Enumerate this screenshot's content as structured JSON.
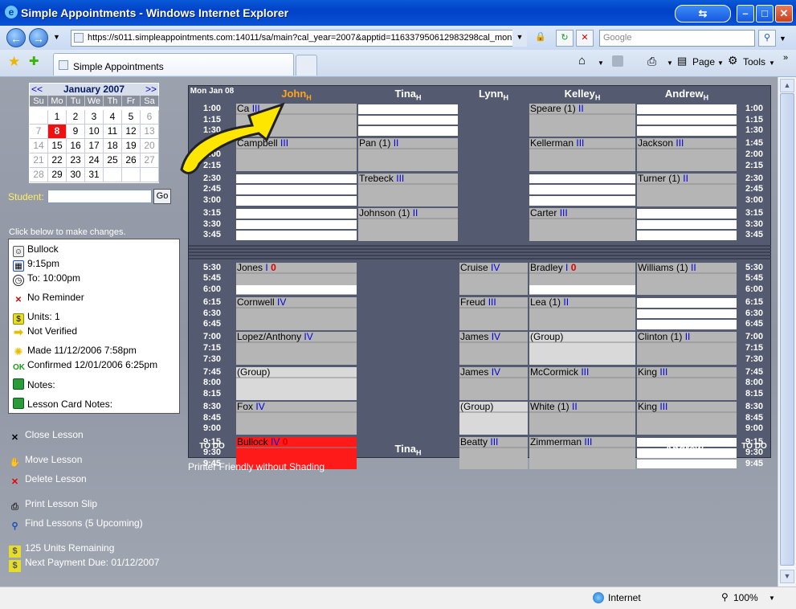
{
  "window": {
    "title": "Simple Appointments - Windows Internet Explorer"
  },
  "browser": {
    "url": "https://s011.simpleappointments.com:14011/sa/main?cal_year=2007&apptid=116337950612983298cal_mon",
    "search_placeholder": "Google",
    "tab_title": "Simple Appointments",
    "page_label": "Page",
    "tools_label": "Tools"
  },
  "status": {
    "zone": "Internet",
    "zoom": "100%"
  },
  "calendar": {
    "prev": "<<",
    "next": ">>",
    "month": "January 2007",
    "day_headers": [
      "Su",
      "Mo",
      "Tu",
      "We",
      "Th",
      "Fr",
      "Sa"
    ],
    "days": [
      [
        "",
        "1",
        "2",
        "3",
        "4",
        "5",
        "6"
      ],
      [
        "7",
        "8",
        "9",
        "10",
        "11",
        "12",
        "13"
      ],
      [
        "14",
        "15",
        "16",
        "17",
        "18",
        "19",
        "20"
      ],
      [
        "21",
        "22",
        "23",
        "24",
        "25",
        "26",
        "27"
      ],
      [
        "28",
        "29",
        "30",
        "31",
        "",
        "",
        ""
      ]
    ]
  },
  "student": {
    "label": "Student:",
    "go": "Go"
  },
  "click_below": "Click below to make changes.",
  "info": {
    "name": "Bullock",
    "time": "9:15pm",
    "to": "To: 10:00pm",
    "reminder": "No Reminder",
    "units": "Units: 1",
    "verified": "Not Verified",
    "made": "Made 11/12/2006 7:58pm",
    "confirmed": "Confirmed 12/01/2006 6:25pm",
    "notes": "Notes:",
    "lesson_card": "Lesson Card Notes:"
  },
  "actions": {
    "close": "Close Lesson",
    "move": "Move Lesson",
    "delete": "Delete Lesson",
    "print": "Print Lesson Slip",
    "find": "Find Lessons (5 Upcoming)",
    "units": "125 Units Remaining",
    "payment": "Next Payment Due: 01/12/2007"
  },
  "schedule": {
    "date": "Mon Jan 08",
    "todo": "TO DO",
    "teachers": [
      "John",
      "Tina",
      "Lynn",
      "Kelley",
      "Andrew"
    ],
    "sub": "H",
    "times_top": [
      "1:00",
      "1:15",
      "1:30",
      "1:45",
      "2:00",
      "2:15",
      "2:30",
      "2:45",
      "3:00",
      "3:15",
      "3:30",
      "3:45"
    ],
    "times_right_top": [
      "1:00",
      "1:15",
      "1:30",
      "1:45",
      "2:00",
      "2:15",
      "2:30",
      "2:45",
      "3:00",
      "3:15",
      "3:30",
      "3:45"
    ],
    "times_bottom": [
      "5:30",
      "5:45",
      "6:00",
      "6:15",
      "6:30",
      "6:45",
      "7:00",
      "7:15",
      "7:30",
      "7:45",
      "8:00",
      "8:15",
      "8:30",
      "8:45",
      "9:00",
      "9:15",
      "9:30",
      "9:45"
    ],
    "cells": {
      "c1": "Ca",
      "c1u": "III",
      "c2": "Campbell",
      "c2u": "III",
      "t1": "Pan (1)",
      "t1u": "II",
      "t2": "Trebeck",
      "t2u": "III",
      "t3": "Johnson (1)",
      "t3u": "II",
      "k1": "Speare (1)",
      "k1u": "II",
      "k2": "Kellerman",
      "k2u": "III",
      "k3": "Carter",
      "k3u": "III",
      "a1": "Jackson",
      "a1u": "III",
      "a2": "Turner (1)",
      "a2u": "II",
      "j5": "Jones",
      "j5u": "I",
      "j5r": "0",
      "j6": "Cornwell",
      "j6u": "IV",
      "j7": "Lopez/Anthony",
      "j7u": "IV",
      "j8": "(Group)",
      "j9": "Fox",
      "j9u": "IV",
      "j10": "Bullock",
      "j10u": "IV",
      "j10r": "0",
      "l5": "Cruise",
      "l5u": "IV",
      "l6": "Freud",
      "l6u": "III",
      "l7": "James",
      "l7u": "IV",
      "l8": "James",
      "l8u": "IV",
      "l9": "(Group)",
      "l10": "Beatty",
      "l10u": "III",
      "k5": "Bradley",
      "k5u": "I",
      "k5r": "0",
      "k6": "Lea (1)",
      "k6u": "II",
      "k7": "(Group)",
      "k8": "McCormick",
      "k8u": "III",
      "k9": "White (1)",
      "k9u": "II",
      "k10": "Zimmerman",
      "k10u": "III",
      "a5": "Williams (1)",
      "a5u": "II",
      "a7": "Clinton (1)",
      "a7u": "II",
      "a8": "King",
      "a8u": "III",
      "a9": "King",
      "a9u": "III"
    }
  },
  "print_link": "Printer Friendly without Shading"
}
